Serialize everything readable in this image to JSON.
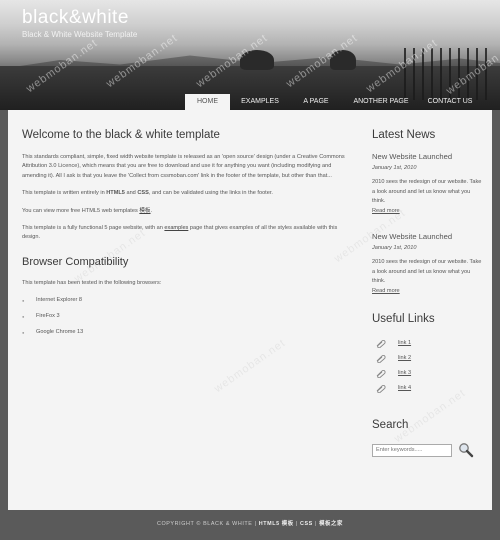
{
  "header": {
    "logo_part1": "black",
    "logo_part2": "&white",
    "tagline": "Black & White Website Template",
    "watermark": "webmoban.net"
  },
  "nav": {
    "items": [
      "HOME",
      "EXAMPLES",
      "A PAGE",
      "ANOTHER PAGE",
      "CONTACT US"
    ],
    "active": "HOME"
  },
  "content": {
    "title": "Welcome to the black & white template",
    "para1": "This standards compliant, simple, fixed width website template is released as an 'open source' design (under a Creative Commons Attribution 3.0 Licence), which means that you are free to download and use it for anything you want (including modifying and amending it). All I ask is that you leave the 'Collect from cssmoban.com' link in the footer of the template, but other than that...",
    "para2_a": "This template is written entirely in ",
    "para2_b": "HTML5",
    "para2_c": " and ",
    "para2_d": "CSS",
    "para2_e": ", and can be validated using the links in the footer.",
    "para3_a": "You can view more free HTML5 web templates ",
    "para3_link": "模板",
    "para3_b": ".",
    "para4_a": "This template is a fully functional 5 page website, with an ",
    "para4_link": "examples",
    "para4_b": " page that gives examples of all the styles available with this design.",
    "compat_title": "Browser Compatibility",
    "compat_intro": "This template has been tested in the following browsers:",
    "browsers": [
      "Internet Explorer 8",
      "FireFox 3",
      "Google Chrome 13"
    ]
  },
  "sidebar": {
    "news_heading": "Latest News",
    "news": [
      {
        "title": "New Website Launched",
        "date": "January 1st, 2010",
        "text": "2010 sees the redesign of our website. Take a look around and let us know what you think.",
        "read_more": "Read more"
      },
      {
        "title": "New Website Launched",
        "date": "January 1st, 2010",
        "text": "2010 sees the redesign of our website. Take a look around and let us know what you think.",
        "read_more": "Read more"
      }
    ],
    "links_heading": "Useful Links",
    "links": [
      "link 1",
      "link 2",
      "link 3",
      "link 4"
    ],
    "search_heading": "Search",
    "search_placeholder": "Enter keywords....."
  },
  "footer": {
    "copyright": "COPYRIGHT © BLACK & WHITE",
    "sep": " | ",
    "html5": "HTML5 模板",
    "css": "CSS",
    "last": "模板之家"
  }
}
